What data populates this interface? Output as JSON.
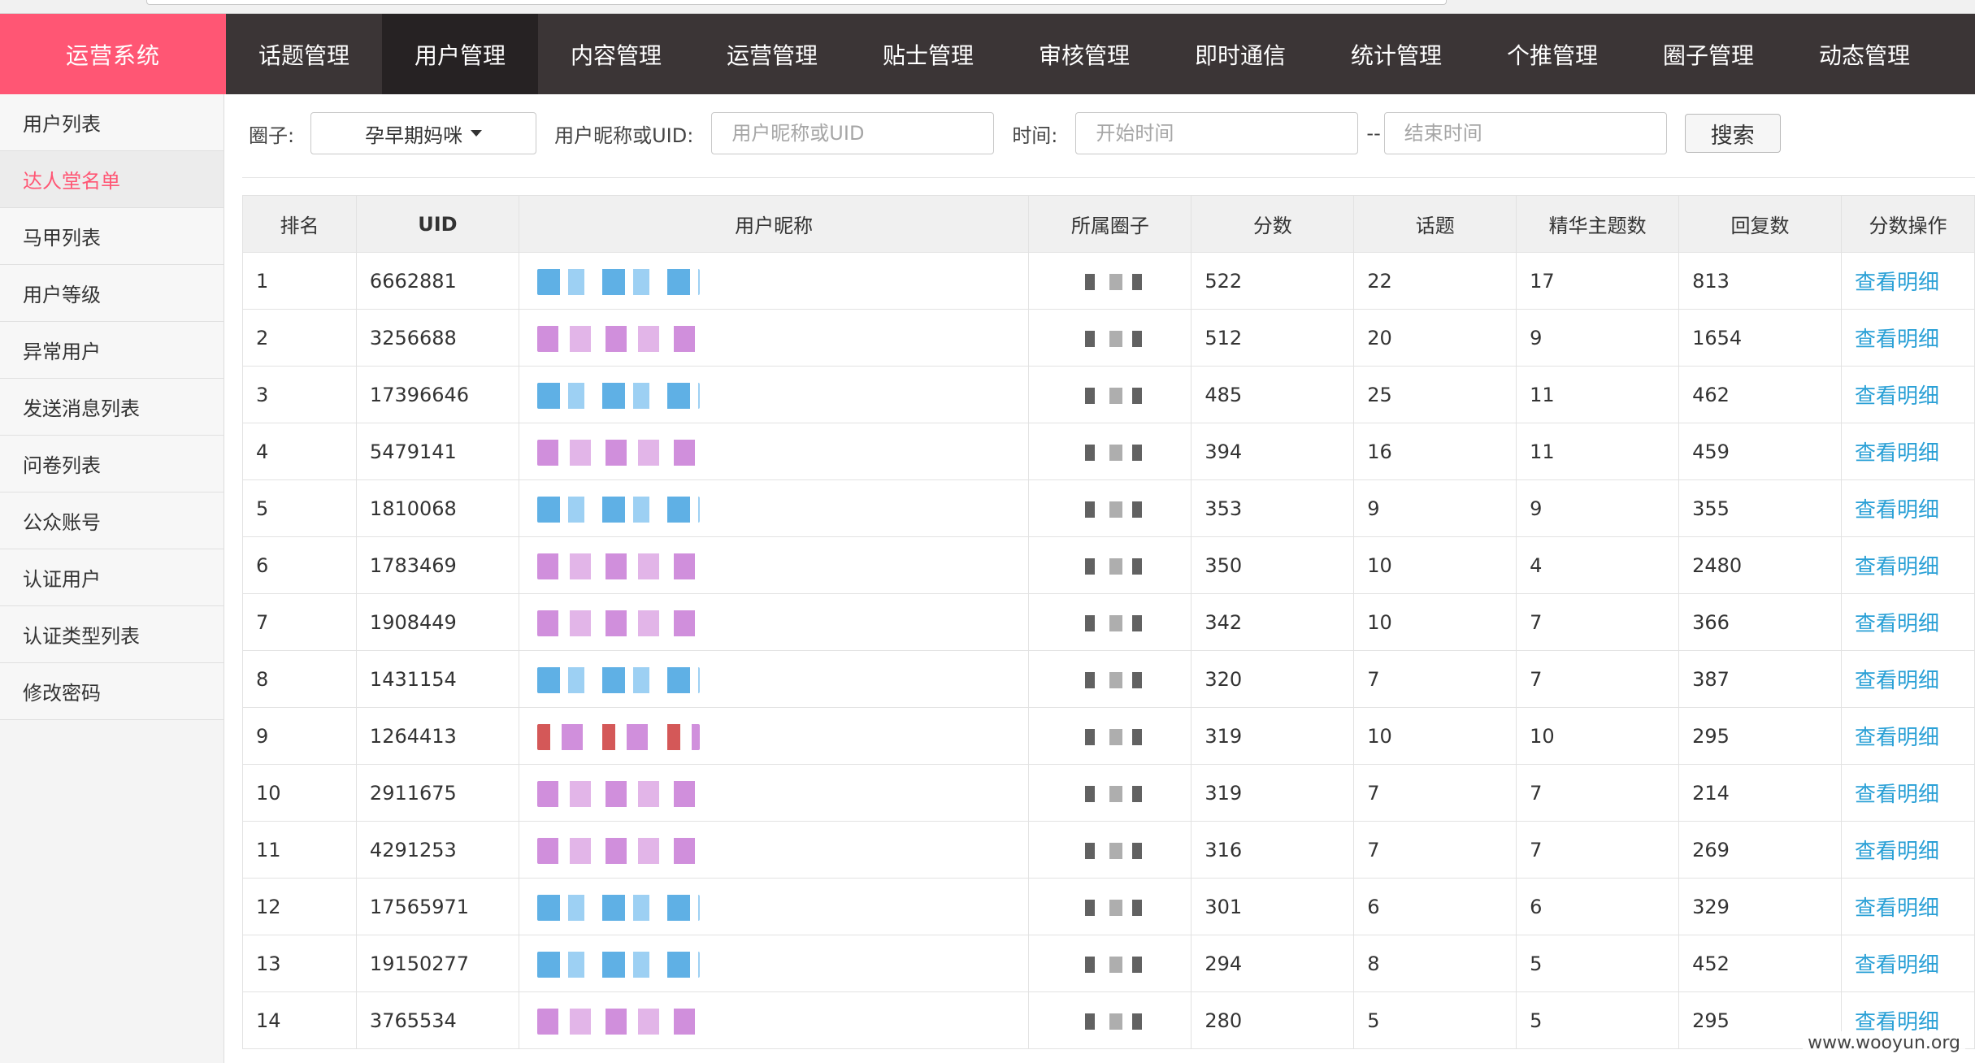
{
  "brand": "运营系统",
  "nav": [
    {
      "label": "话题管理",
      "active": false
    },
    {
      "label": "用户管理",
      "active": true
    },
    {
      "label": "内容管理",
      "active": false
    },
    {
      "label": "运营管理",
      "active": false
    },
    {
      "label": "贴士管理",
      "active": false
    },
    {
      "label": "审核管理",
      "active": false
    },
    {
      "label": "即时通信",
      "active": false
    },
    {
      "label": "统计管理",
      "active": false
    },
    {
      "label": "个推管理",
      "active": false
    },
    {
      "label": "圈子管理",
      "active": false
    },
    {
      "label": "动态管理",
      "active": false
    }
  ],
  "sidebar": [
    {
      "label": "用户列表",
      "active": false
    },
    {
      "label": "达人堂名单",
      "active": true
    },
    {
      "label": "马甲列表",
      "active": false
    },
    {
      "label": "用户等级",
      "active": false
    },
    {
      "label": "异常用户",
      "active": false
    },
    {
      "label": "发送消息列表",
      "active": false
    },
    {
      "label": "问卷列表",
      "active": false
    },
    {
      "label": "公众账号",
      "active": false
    },
    {
      "label": "认证用户",
      "active": false
    },
    {
      "label": "认证类型列表",
      "active": false
    },
    {
      "label": "修改密码",
      "active": false
    }
  ],
  "filter": {
    "circle_label": "圈子:",
    "circle_value": "孕早期妈咪",
    "user_label": "用户昵称或UID:",
    "user_placeholder": "用户昵称或UID",
    "time_label": "时间:",
    "start_placeholder": "开始时间",
    "separator": "--",
    "end_placeholder": "结束时间",
    "search_label": "搜索"
  },
  "table": {
    "headers": [
      "排名",
      "UID",
      "用户昵称",
      "所属圈子",
      "分数",
      "话题",
      "精华主题数",
      "回复数",
      "分数操作"
    ],
    "action_label": "查看明细",
    "rows": [
      {
        "rank": "1",
        "uid": "6662881",
        "score": "522",
        "topics": "22",
        "featured": "17",
        "replies": "813",
        "color": "blue"
      },
      {
        "rank": "2",
        "uid": "3256688",
        "score": "512",
        "topics": "20",
        "featured": "9",
        "replies": "1654",
        "color": "pink"
      },
      {
        "rank": "3",
        "uid": "17396646",
        "score": "485",
        "topics": "25",
        "featured": "11",
        "replies": "462",
        "color": "blue"
      },
      {
        "rank": "4",
        "uid": "5479141",
        "score": "394",
        "topics": "16",
        "featured": "11",
        "replies": "459",
        "color": "pink"
      },
      {
        "rank": "5",
        "uid": "1810068",
        "score": "353",
        "topics": "9",
        "featured": "9",
        "replies": "355",
        "color": "blue"
      },
      {
        "rank": "6",
        "uid": "1783469",
        "score": "350",
        "topics": "10",
        "featured": "4",
        "replies": "2480",
        "color": "pink"
      },
      {
        "rank": "7",
        "uid": "1908449",
        "score": "342",
        "topics": "10",
        "featured": "7",
        "replies": "366",
        "color": "pink"
      },
      {
        "rank": "8",
        "uid": "1431154",
        "score": "320",
        "topics": "7",
        "featured": "7",
        "replies": "387",
        "color": "blue"
      },
      {
        "rank": "9",
        "uid": "1264413",
        "score": "319",
        "topics": "10",
        "featured": "10",
        "replies": "295",
        "color": "red"
      },
      {
        "rank": "10",
        "uid": "2911675",
        "score": "319",
        "topics": "7",
        "featured": "7",
        "replies": "214",
        "color": "pink"
      },
      {
        "rank": "11",
        "uid": "4291253",
        "score": "316",
        "topics": "7",
        "featured": "7",
        "replies": "269",
        "color": "pink"
      },
      {
        "rank": "12",
        "uid": "17565971",
        "score": "301",
        "topics": "6",
        "featured": "6",
        "replies": "329",
        "color": "blue"
      },
      {
        "rank": "13",
        "uid": "19150277",
        "score": "294",
        "topics": "8",
        "featured": "5",
        "replies": "452",
        "color": "blue"
      },
      {
        "rank": "14",
        "uid": "3765534",
        "score": "280",
        "topics": "5",
        "featured": "5",
        "replies": "295",
        "color": "pink"
      }
    ]
  },
  "watermark": "www.wooyun.org"
}
